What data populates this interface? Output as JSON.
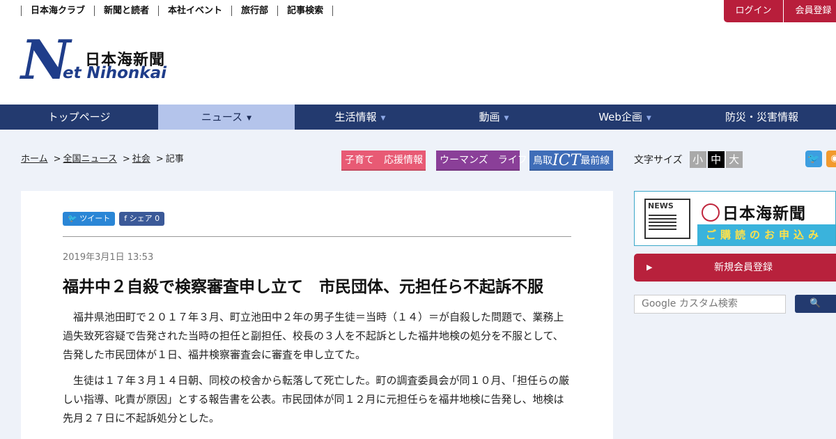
{
  "top_links": [
    "日本海クラブ",
    "新聞と読者",
    "本社イベント",
    "旅行部",
    "記事検索"
  ],
  "auth": {
    "login": "ログイン",
    "register": "会員登録"
  },
  "logo": {
    "mark": "N",
    "jp": "日本海新聞",
    "en": "et Nihonkai"
  },
  "nav": [
    {
      "label": "トップページ",
      "arrow": ""
    },
    {
      "label": "ニュース",
      "arrow": "▼"
    },
    {
      "label": "生活情報",
      "arrow": "▼"
    },
    {
      "label": "動画",
      "arrow": "▼"
    },
    {
      "label": "Web企画",
      "arrow": "▼"
    },
    {
      "label": "防災・災害情報",
      "arrow": ""
    }
  ],
  "breadcrumb": {
    "home": "ホーム",
    "national": "全国ニュース",
    "society": "社会",
    "current": "記事",
    "sep": ">"
  },
  "banners": {
    "kosodate": "子育て　応援情報",
    "womans": "ウーマンズ　ライフ",
    "tottori": "鳥取",
    "ict": "ICT",
    "saizensen": "最前線"
  },
  "font_size": {
    "label": "文字サイズ",
    "small": "小",
    "medium": "中",
    "large": "大"
  },
  "share": {
    "tweet": "ツイート",
    "facebook": "シェア 0"
  },
  "article": {
    "date": "2019年3月1日 13:53",
    "headline": "福井中２自殺で検察審査申し立て　市民団体、元担任ら不起訴不服",
    "paragraphs": [
      "福井県池田町で２０１７年３月、町立池田中２年の男子生徒＝当時（１４）＝が自殺した問題で、業務上過失致死容疑で告発された当時の担任と副担任、校長の３人を不起訴とした福井地検の処分を不服として、告発した市民団体が１日、福井検察審査会に審査を申し立てた。",
      "生徒は１７年３月１４日朝、同校の校舎から転落して死亡した。町の調査委員会が同１０月、「担任らの厳しい指導、叱責が原因」とする報告書を公表。市民団体が同１２月に元担任らを福井地検に告発し、地検は先月２７日に不起訴処分とした。"
    ]
  },
  "sidebar": {
    "paper_label": "NEWS",
    "sub_title": "日本海新聞",
    "sub_strip": "ご購読のお申込み",
    "new_register": "新規会員登録",
    "search_placeholder": "Google カスタム検索",
    "search_icon": "search-icon"
  },
  "colors": {
    "nav_bg": "#233a6f",
    "accent_red": "#b81e3b",
    "nav_active": "#b4c4eb"
  }
}
